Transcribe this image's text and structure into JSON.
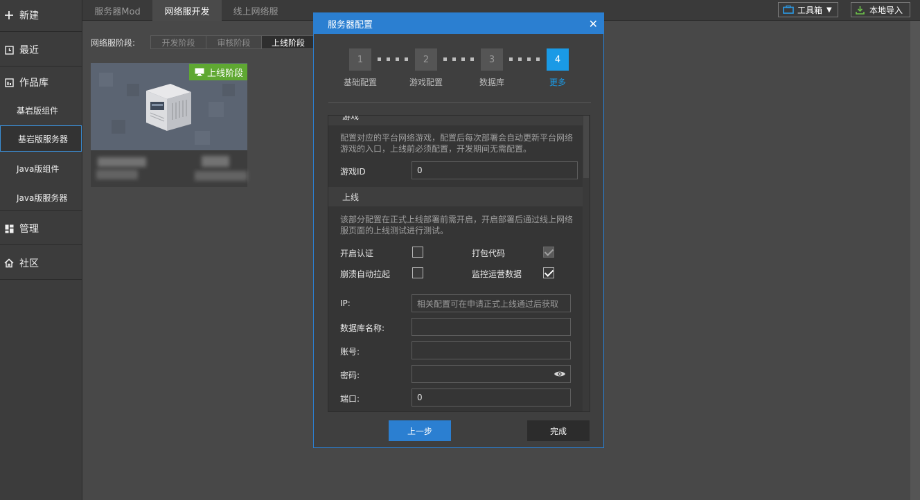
{
  "sidebar": {
    "new": "新建",
    "recent": "最近",
    "library": "作品库",
    "sub": [
      "基岩版组件",
      "基岩版服务器",
      "Java版组件",
      "Java版服务器"
    ],
    "manage": "管理",
    "community": "社区"
  },
  "tabs": [
    "服务器Mod",
    "网络服开发",
    "线上网络服"
  ],
  "toolbar": {
    "toolbox": "工具箱",
    "import": "本地导入"
  },
  "stages": {
    "label": "网络服阶段:",
    "items": [
      "开发阶段",
      "审核阶段",
      "上线阶段"
    ]
  },
  "card": {
    "badge": "上线阶段"
  },
  "modal": {
    "title": "服务器配置",
    "steps": [
      {
        "num": "1",
        "label": "基础配置"
      },
      {
        "num": "2",
        "label": "游戏配置"
      },
      {
        "num": "3",
        "label": "数据库"
      },
      {
        "num": "4",
        "label": "更多"
      }
    ],
    "game": {
      "title": "游戏",
      "desc": "配置对应的平台网络游戏，配置后每次部署会自动更新平台网络游戏的入口，上线前必须配置，开发期间无需配置。",
      "id_label": "游戏ID",
      "id_value": "0"
    },
    "online": {
      "title": "上线",
      "desc": "该部分配置在正式上线部署前需开启，开启部署后通过线上网络服页面的上线测试进行测试。",
      "auth": "开启认证",
      "pack": "打包代码",
      "crash": "崩溃自动拉起",
      "monitor": "监控运营数据",
      "ip_label": "IP:",
      "ip_placeholder": "相关配置可在申请正式上线通过后获取",
      "db_label": "数据库名称:",
      "account_label": "账号:",
      "password_label": "密码:",
      "port_label": "端口:",
      "port_value": "0"
    },
    "prev": "上一步",
    "finish": "完成"
  }
}
